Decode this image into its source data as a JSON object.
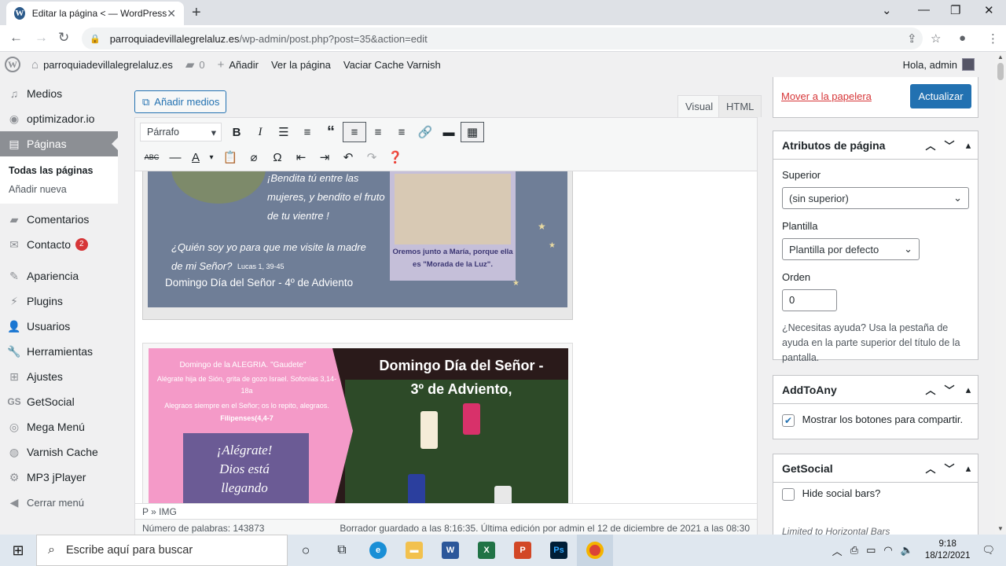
{
  "browser": {
    "tab_title": "Editar la página < — WordPress",
    "tab_close": "✕",
    "new_tab": "+",
    "url_host": "parroquiadevillalegrelaluz.es",
    "url_path": "/wp-admin/post.php?post=35&action=edit"
  },
  "adminbar": {
    "wp_logo": "W",
    "site_name": "parroquiadevillalegrelaluz.es",
    "comments_count": "0",
    "add_new": "Añadir",
    "view_page": "Ver la página",
    "purge_cache": "Vaciar Cache Varnish",
    "greeting": "Hola, admin"
  },
  "sidebar": {
    "items": [
      {
        "label": "Medios",
        "icon": "media-icon"
      },
      {
        "label": "optimizador.io",
        "icon": "optimizer-icon"
      },
      {
        "label": "Páginas",
        "icon": "pages-icon"
      },
      {
        "label": "Comentarios",
        "icon": "comments-icon"
      },
      {
        "label": "Contacto",
        "icon": "mail-icon",
        "badge": "2"
      },
      {
        "label": "Apariencia",
        "icon": "appearance-icon"
      },
      {
        "label": "Plugins",
        "icon": "plugins-icon"
      },
      {
        "label": "Usuarios",
        "icon": "users-icon"
      },
      {
        "label": "Herramientas",
        "icon": "tools-icon"
      },
      {
        "label": "Ajustes",
        "icon": "settings-icon"
      },
      {
        "label": "GetSocial",
        "icon": "getsocial-icon"
      },
      {
        "label": "Mega Menú",
        "icon": "megamenu-icon"
      },
      {
        "label": "Varnish Cache",
        "icon": "varnish-icon"
      },
      {
        "label": "MP3 jPlayer",
        "icon": "mp3-icon"
      },
      {
        "label": "Cerrar menú",
        "icon": "collapse-icon"
      }
    ],
    "submenu": [
      "Todas las páginas",
      "Añadir nueva"
    ]
  },
  "editor": {
    "add_media": "Añadir medios",
    "tab_visual": "Visual",
    "tab_html": "HTML",
    "format_select": "Párrafo",
    "path": "P » IMG",
    "word_count": "Número de palabras: 143873",
    "autosave": "Borrador guardado a las 8:16:35. Última edición por admin el 12 de diciembre de 2021 a las 08:30"
  },
  "image1": {
    "line1": "¡Bendita tú entre las",
    "line2": "mujeres, y bendito el fruto",
    "line3": "de tu vientre !",
    "quote": "¿Quién soy yo para que me visite la madre",
    "quote2": "de mi Señor?",
    "ref": "Lucas 1, 39-45",
    "caption": "Oremos junto a María, porque ella es \"Morada de la Luz\".",
    "footer": "Domingo Día del Señor - 4º de Adviento"
  },
  "image2": {
    "pink_title": "Domingo de la ALEGRIA. \"Gaudete\"",
    "pink_l1": "Alégrate hija de Sión, grita de gozo Israel. Sofonías 3,14-18a",
    "pink_l2": "Alegraos siempre en el Señor; os lo repito, alegraos.",
    "pink_l3": "Filipenses(4,4-7",
    "title1": "Domingo Día del Señor -",
    "title2": "3º de Adviento,",
    "mary_text": "¡Alégrate! Dios está llegando"
  },
  "publish": {
    "trash": "Mover a la papelera",
    "update": "Actualizar"
  },
  "page_attributes": {
    "title": "Atributos de página",
    "parent_label": "Superior",
    "parent_value": "(sin superior)",
    "template_label": "Plantilla",
    "template_value": "Plantilla por defecto",
    "order_label": "Orden",
    "order_value": "0",
    "help": "¿Necesitas ayuda? Usa la pestaña de ayuda en la parte superior del título de la pantalla."
  },
  "addtoany": {
    "title": "AddToAny",
    "checkbox_label": "Mostrar los botones para compartir.",
    "checked": true
  },
  "getsocial": {
    "title": "GetSocial",
    "checkbox_label": "Hide social bars?",
    "note": "Limited to Horizontal Bars"
  },
  "taskbar": {
    "search_placeholder": "Escribe aquí para buscar",
    "time": "9:18",
    "date": "18/12/2021"
  },
  "colors": {
    "wp_blue": "#2271b1",
    "trash_red": "#d63638",
    "menu_current": "#8c8f94"
  }
}
